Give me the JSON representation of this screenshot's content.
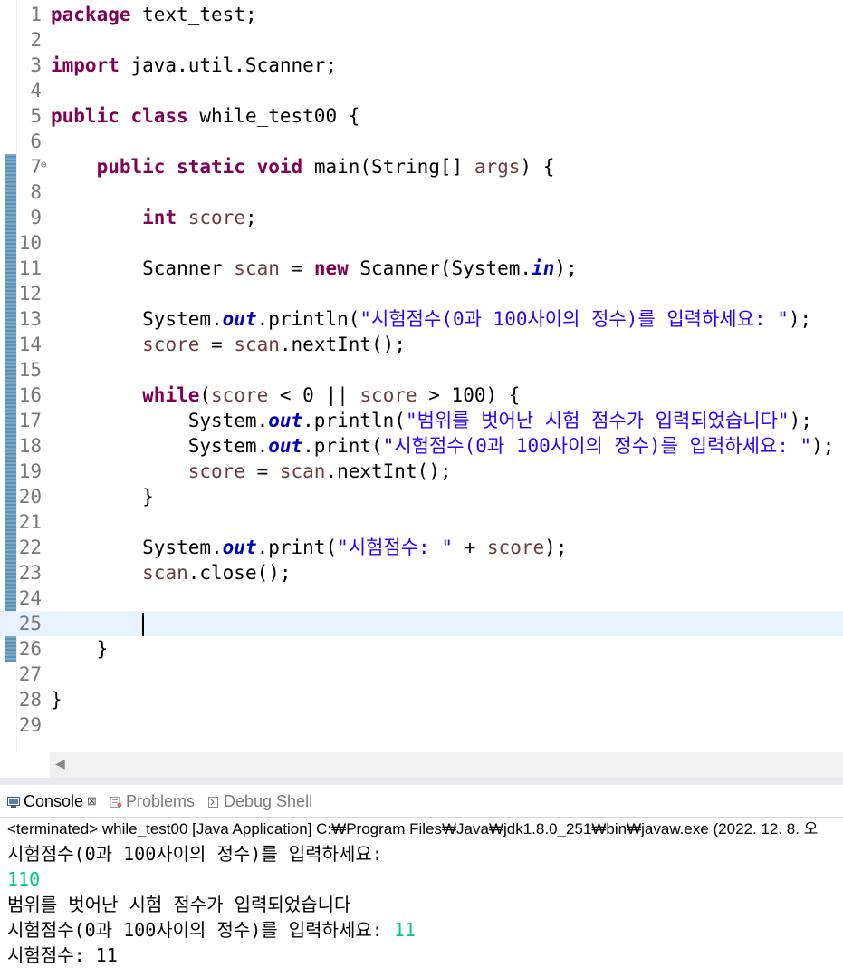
{
  "editor": {
    "current_line": 25,
    "lines": [
      {
        "n": "1",
        "html": "<span class='kw'>package</span> text_test;"
      },
      {
        "n": "2",
        "html": ""
      },
      {
        "n": "3",
        "html": "<span class='kw'>import</span> java.util.Scanner;"
      },
      {
        "n": "4",
        "html": ""
      },
      {
        "n": "5",
        "html": "<span class='kw'>public</span> <span class='kw'>class</span> while_test00 {"
      },
      {
        "n": "6",
        "html": ""
      },
      {
        "n": "7",
        "fold": "⊖",
        "html": "    <span class='kw'>public</span> <span class='kw'>static</span> <span class='kw'>void</span> main(String[] <span class='var'>args</span>) {"
      },
      {
        "n": "8",
        "html": ""
      },
      {
        "n": "9",
        "html": "        <span class='kw'>int</span> <span class='var'>score</span>;"
      },
      {
        "n": "10",
        "html": ""
      },
      {
        "n": "11",
        "html": "        Scanner <span class='var'>scan</span> = <span class='kw'>new</span> Scanner(System.<span class='sfield'>in</span>);"
      },
      {
        "n": "12",
        "html": ""
      },
      {
        "n": "13",
        "html": "        System.<span class='sfield'>out</span>.println(<span class='str'>\"시험점수(0과 100사이의 정수)를 입력하세요: \"</span>);"
      },
      {
        "n": "14",
        "html": "        <span class='var'>score</span> = <span class='var'>scan</span>.nextInt();"
      },
      {
        "n": "15",
        "html": ""
      },
      {
        "n": "16",
        "html": "        <span class='kw'>while</span>(<span class='var'>score</span> &lt; 0 || <span class='var'>score</span> &gt; 100) {"
      },
      {
        "n": "17",
        "html": "            System.<span class='sfield'>out</span>.println(<span class='str'>\"범위를 벗어난 시험 점수가 입력되었습니다\"</span>);"
      },
      {
        "n": "18",
        "html": "            System.<span class='sfield'>out</span>.print(<span class='str'>\"시험점수(0과 100사이의 정수)를 입력하세요: \"</span>);"
      },
      {
        "n": "19",
        "html": "            <span class='var'>score</span> = <span class='var'>scan</span>.nextInt();"
      },
      {
        "n": "20",
        "html": "        }"
      },
      {
        "n": "21",
        "html": ""
      },
      {
        "n": "22",
        "html": "        System.<span class='sfield'>out</span>.print(<span class='str'>\"시험점수: \"</span> + <span class='var'>score</span>);"
      },
      {
        "n": "23",
        "html": "        <span class='var'>scan</span>.close();"
      },
      {
        "n": "24",
        "html": ""
      },
      {
        "n": "25",
        "html": "        <span class='caret'></span>"
      },
      {
        "n": "26",
        "html": "    }"
      },
      {
        "n": "27",
        "html": ""
      },
      {
        "n": "28",
        "html": "}"
      },
      {
        "n": "29",
        "html": ""
      }
    ]
  },
  "tabs": {
    "console": "Console",
    "console_close": "⊠",
    "problems": "Problems",
    "debug_shell": "Debug Shell"
  },
  "console": {
    "status": "<terminated> while_test00 [Java Application] C:₩Program Files₩Java₩jdk1.8.0_251₩bin₩javaw.exe  (2022. 12. 8. 오",
    "output": [
      {
        "text": "시험점수(0과 100사이의 정수)를 입력하세요: ",
        "input": ""
      },
      {
        "text": "",
        "input": "110"
      },
      {
        "text": "범위를 벗어난 시험 점수가 입력되었습니다",
        "input": ""
      },
      {
        "text": "시험점수(0과 100사이의 정수)를 입력하세요: ",
        "input": "11"
      },
      {
        "text": "시험점수: 11",
        "input": ""
      }
    ]
  },
  "colors": {
    "keyword": "#7f0055",
    "string": "#2a00ff",
    "local_variable": "#6a3e3e",
    "static_field": "#0000c0",
    "console_input": "#00c87f",
    "current_line": "#e8f2fe"
  }
}
